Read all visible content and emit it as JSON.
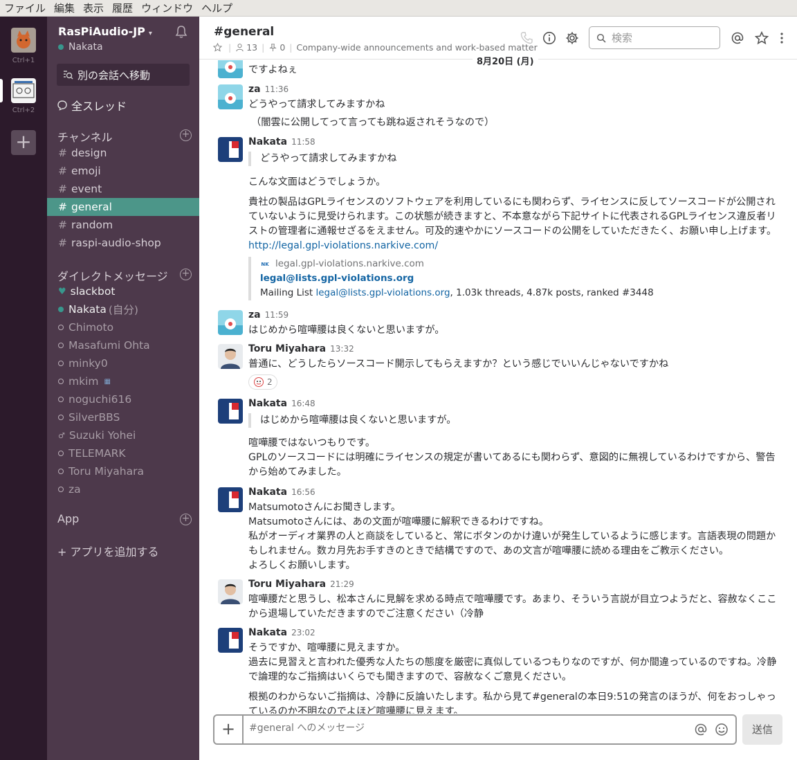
{
  "menubar": [
    "ファイル",
    "編集",
    "表示",
    "履歴",
    "ウィンドウ",
    "ヘルプ"
  ],
  "teams": {
    "key1": "Ctrl+1",
    "key2": "Ctrl+2",
    "add": "+"
  },
  "sidebar": {
    "workspace": "RasPiAudio-JP",
    "user": "Nakata",
    "jump": "別の会話へ移動",
    "threads": "全スレッド",
    "channels_header": "チャンネル",
    "channels": [
      "design",
      "emoji",
      "event",
      "general",
      "random",
      "raspi-audio-shop"
    ],
    "dm_header": "ダイレクトメッセージ",
    "dms": [
      "slackbot",
      "Nakata",
      "Chimoto",
      "Masafumi Ohta",
      "minky0",
      "mkim",
      "noguchi616",
      "SilverBBS",
      "Suzuki Yohei",
      "TELEMARK",
      "Toru Miyahara",
      "za"
    ],
    "you_label": "(自分)",
    "app_header": "App",
    "add_app": "+ アプリを追加する"
  },
  "header": {
    "title": "#general",
    "members": "13",
    "pins": "0",
    "topic": "Company-wide announcements and work-based matter",
    "search_placeholder": "検索"
  },
  "date_divider": "8月20日 (月)",
  "messages": {
    "m0": {
      "text": "ですよねぇ"
    },
    "m1": {
      "author": "za",
      "time": "11:36",
      "l1": "どうやって請求してみますかね",
      "l2": "（闇雲に公開してって言っても跳ね返されそうなので）"
    },
    "m2": {
      "author": "Nakata",
      "time": "11:58",
      "quote": "どうやって請求してみますかね",
      "l1": "こんな文面はどうでしょうか。",
      "p1": "貴社の製品はGPLライセンスのソフトウェアを利用しているにも関わらず、ライセンスに反してソースコードが公開されていないように見受けられます。この状態が続きますと、不本意ながら下記サイトに代表されるGPLライセンス違反者リストの管理者に通報せざるをえません。可及的速やかにソースコードの公開をしていただきたく、お願い申し上げます。",
      "link": "http://legal.gpl-violations.narkive.com/",
      "unfurl_icon": "NK",
      "unfurl_service": "legal.gpl-violations.narkive.com",
      "unfurl_title": "legal@lists.gpl-violations.org",
      "unfurl_desc_pre": "Mailing List ",
      "unfurl_desc_link": "legal@lists.gpl-violations.org",
      "unfurl_desc_post": ", 1.03k threads, 4.87k posts, ranked #3448"
    },
    "m3": {
      "author": "za",
      "time": "11:59",
      "l1": "はじめから喧嘩腰は良くないと思いますが。"
    },
    "m4": {
      "author": "Toru Miyahara",
      "time": "13:32",
      "l1": "普通に、どうしたらソースコード開示してもらえますか？という感じでいいんじゃないですかね",
      "reaction_count": "2"
    },
    "m5": {
      "author": "Nakata",
      "time": "16:48",
      "quote": "はじめから喧嘩腰は良くないと思いますが。",
      "l1": "喧嘩腰ではないつもりです。",
      "p1": "GPLのソースコードには明確にライセンスの規定が書いてあるにも関わらず、意図的に無視しているわけですから、警告から始めてみました。"
    },
    "m6": {
      "author": "Nakata",
      "time": "16:56",
      "l1": "Matsumotoさんにお聞きします。",
      "l2": "Matsumotoさんには、あの文面が喧嘩腰に解釈できるわけですね。",
      "p1": "私がオーディオ業界の人と商談をしていると、常にボタンのかけ違いが発生しているように感じます。言語表現の問題かもしれません。数カ月先お手すきのときで結構ですので、あの文言が喧嘩腰に読める理由をご教示ください。",
      "l3": "よろしくお願いします。"
    },
    "m7": {
      "author": "Toru Miyahara",
      "time": "21:29",
      "p1": "喧嘩腰だと思うし、松本さんに見解を求める時点で喧嘩腰です。あまり、そういう言説が目立つようだと、容赦なくここから退場していただきますのでご注意ください（冷静"
    },
    "m8": {
      "author": "Nakata",
      "time": "23:02",
      "l1": "そうですか、喧嘩腰に見えますか。",
      "p1": "過去に見習えと言われた優秀な人たちの態度を厳密に真似しているつもりなのですが、何か間違っているのですね。冷静で論理的なご指摘はいくらでも聞きますので、容赦なくご意見ください。",
      "p2": "根拠のわからないご指摘は、冷静に反論いたします。私から見て#generalの本日9:51の発言のほうが、何をおっしゃっているのか不明なのでよほど喧嘩腰に見えます。"
    }
  },
  "composer": {
    "placeholder": "#general へのメッセージ",
    "send": "送信",
    "plus": "+"
  },
  "colors": {
    "sidebar": "#4d394b",
    "teams": "#2c1a2b",
    "selected": "#4c9689",
    "link": "#1264a3"
  }
}
